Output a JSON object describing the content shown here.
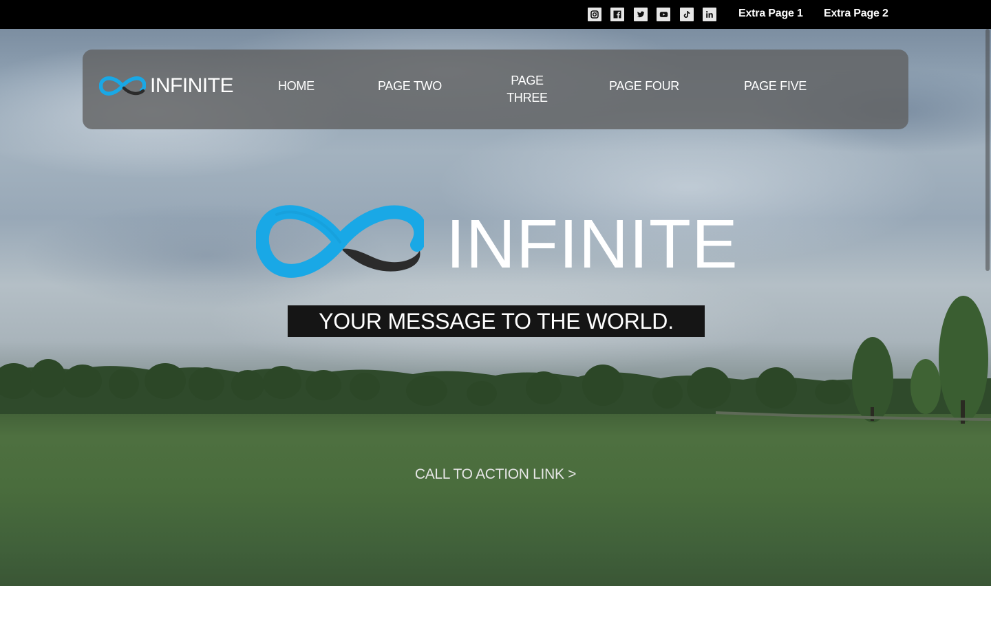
{
  "topbar": {
    "social_icons": [
      {
        "name": "instagram-icon"
      },
      {
        "name": "facebook-icon"
      },
      {
        "name": "twitter-icon"
      },
      {
        "name": "youtube-icon"
      },
      {
        "name": "tiktok-icon"
      },
      {
        "name": "linkedin-icon"
      }
    ],
    "links": [
      "Extra Page 1",
      "Extra Page 2"
    ]
  },
  "nav": {
    "logo_text": "INFINITE",
    "items": [
      "HOME",
      "PAGE TWO",
      "PAGE THREE",
      "PAGE FOUR",
      "PAGE FIVE"
    ]
  },
  "hero": {
    "logo_text": "INFINITE",
    "tagline": "YOUR MESSAGE TO THE WORLD.",
    "cta": "CALL TO ACTION LINK >"
  },
  "colors": {
    "brand_blue": "#19a8e6",
    "logo_dark": "#2b2b2b",
    "topbar_bg": "#000000",
    "tagline_bg": "#151515"
  }
}
